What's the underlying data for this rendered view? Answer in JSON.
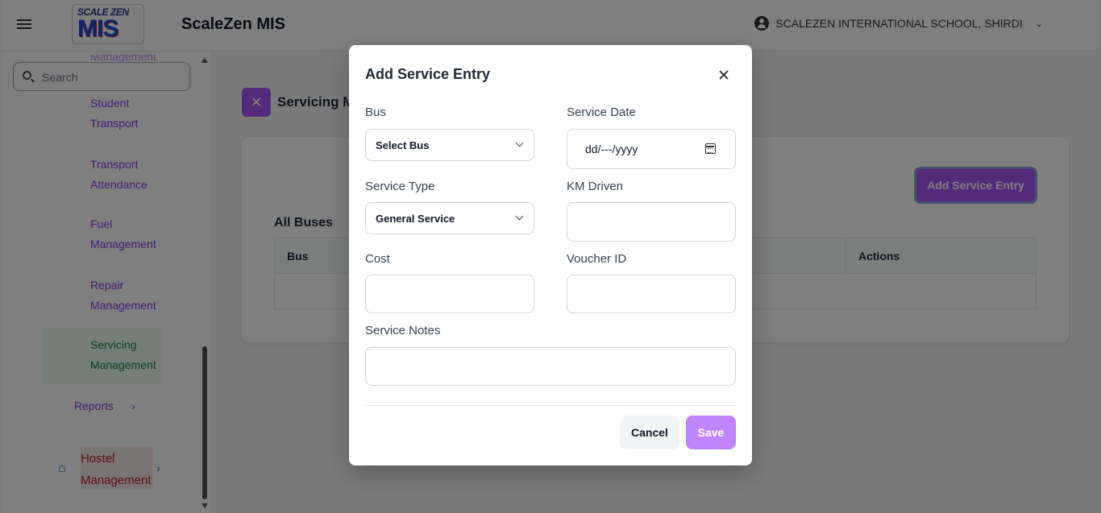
{
  "header": {
    "logo_top": "SCALE ZEN",
    "logo_main": "MIS",
    "app_title": "ScaleZen MIS",
    "organization": "SCALEZEN INTERNATIONAL SCHOOL, SHIRDI"
  },
  "sidebar": {
    "search_placeholder": "Search",
    "cut_item": "Management",
    "items": [
      {
        "line1": "Student",
        "line2": "Transport"
      },
      {
        "line1": "Transport",
        "line2": "Attendance"
      },
      {
        "line1": "Fuel",
        "line2": "Management"
      },
      {
        "line1": "Repair",
        "line2": "Management"
      }
    ],
    "active_item": {
      "line1": "Servicing",
      "line2": "Management"
    },
    "reports": "Reports",
    "hostel": {
      "line1": "Hostel",
      "line2": "Management"
    }
  },
  "main": {
    "page_title": "Servicing M",
    "add_button": "Add Service Entry",
    "section_label": "All Buses",
    "table_headers": [
      "Bus",
      "Actions"
    ]
  },
  "modal": {
    "title": "Add Service Entry",
    "fields": {
      "bus_label": "Bus",
      "bus_value": "Select Bus",
      "service_date_label": "Service Date",
      "service_date_value": "dd/---/yyyy",
      "service_type_label": "Service Type",
      "service_type_value": "General Service",
      "km_label": "KM Driven",
      "cost_label": "Cost",
      "voucher_label": "Voucher ID",
      "notes_label": "Service Notes"
    },
    "cancel": "Cancel",
    "save": "Save"
  },
  "colors": {
    "accent": "#a855f7",
    "sidebar_link": "#9333ea",
    "active_link": "#15803d",
    "hostel": "#b91c1c"
  }
}
